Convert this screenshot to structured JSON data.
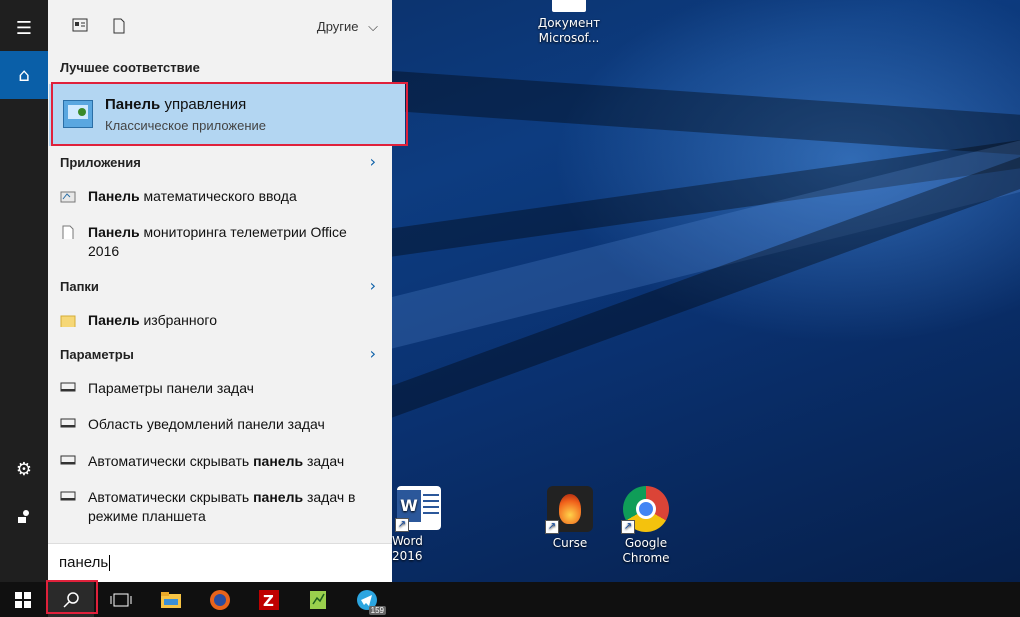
{
  "desktop": {
    "icons": [
      {
        "label": "Документ\nMicrosof..."
      },
      {
        "label": "Word 2016"
      },
      {
        "label": "Curse"
      },
      {
        "label": "Google\nChrome"
      }
    ]
  },
  "search_panel": {
    "filter_label": "Другие",
    "best_match": {
      "header": "Лучшее соответствие",
      "title_bold": "Панель",
      "title_rest": " управления",
      "subtitle": "Классическое приложение"
    },
    "sections": {
      "apps": "Приложения",
      "folders": "Папки",
      "settings": "Параметры"
    },
    "apps": [
      {
        "bold": "Панель",
        "rest": " математического ввода"
      },
      {
        "bold": "Панель",
        "rest": " мониторинга телеметрии Office 2016"
      }
    ],
    "folders": [
      {
        "bold": "Панель",
        "rest": " избранного"
      }
    ],
    "settings": [
      {
        "pre": "Параметры панели задач",
        "bold": "",
        "post": ""
      },
      {
        "pre": "Область уведомлений панели задач",
        "bold": "",
        "post": ""
      },
      {
        "pre": "Автоматически скрывать ",
        "bold": "панель",
        "post": " задач"
      },
      {
        "pre": "Автоматически скрывать ",
        "bold": "панель",
        "post": " задач в режиме планшета"
      }
    ],
    "query": "панель"
  },
  "taskbar": {
    "telegram_badge": "159"
  },
  "colors": {
    "accent": "#0a5fa8",
    "highlight": "#b3d6f2",
    "annotation_red": "#e0213b"
  }
}
